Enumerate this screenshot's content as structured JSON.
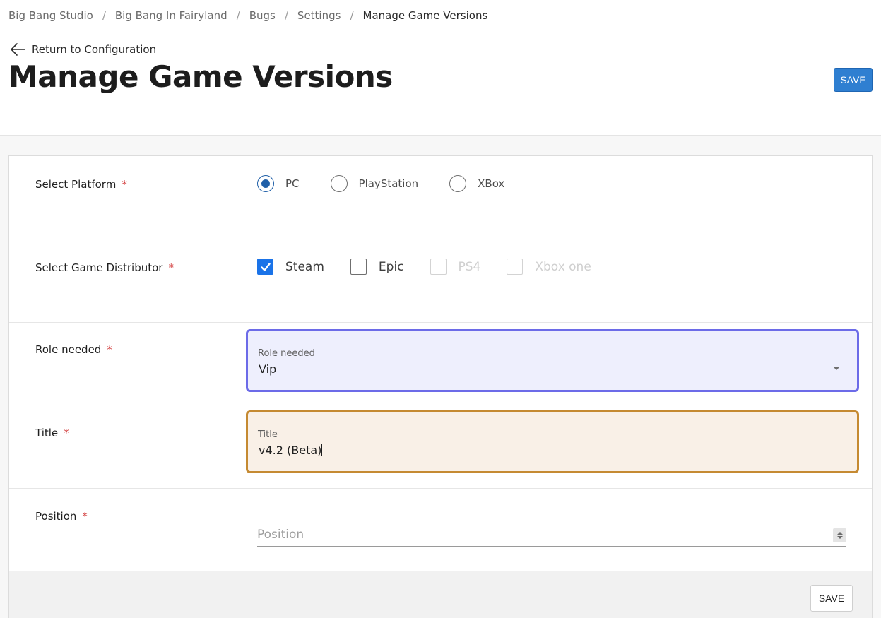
{
  "breadcrumb": {
    "items": [
      "Big Bang Studio",
      "Big Bang In Fairyland",
      "Bugs",
      "Settings",
      "Manage Game Versions"
    ],
    "separator": "/"
  },
  "back_link": {
    "label": "Return to Configuration",
    "icon": "arrow-left-icon"
  },
  "page_title": "Manage Game Versions",
  "toolbar": {
    "save_label": "SAVE"
  },
  "form": {
    "required_marker": "*",
    "platform": {
      "label": "Select Platform",
      "options": [
        {
          "label": "PC",
          "checked": true
        },
        {
          "label": "PlayStation",
          "checked": false
        },
        {
          "label": "XBox",
          "checked": false
        }
      ]
    },
    "distributor": {
      "label": "Select Game Distributor",
      "options": [
        {
          "label": "Steam",
          "checked": true,
          "disabled": false
        },
        {
          "label": "Epic",
          "checked": false,
          "disabled": false
        },
        {
          "label": "PS4",
          "checked": false,
          "disabled": true
        },
        {
          "label": "Xbox one",
          "checked": false,
          "disabled": true
        }
      ]
    },
    "role": {
      "label": "Role needed",
      "field_label": "Role needed",
      "value": "Vip"
    },
    "title": {
      "label": "Title",
      "field_label": "Title",
      "value": "v4.2 (Beta)"
    },
    "position": {
      "label": "Position",
      "placeholder": "Position"
    }
  },
  "footer": {
    "save_label": "SAVE"
  },
  "colors": {
    "primary": "#2f7fd1",
    "checkbox": "#1a73e8",
    "radio": "#1f5fa8",
    "role_focus": "#6c6be8",
    "title_focus": "#c58a32",
    "required": "#d23b3b"
  }
}
